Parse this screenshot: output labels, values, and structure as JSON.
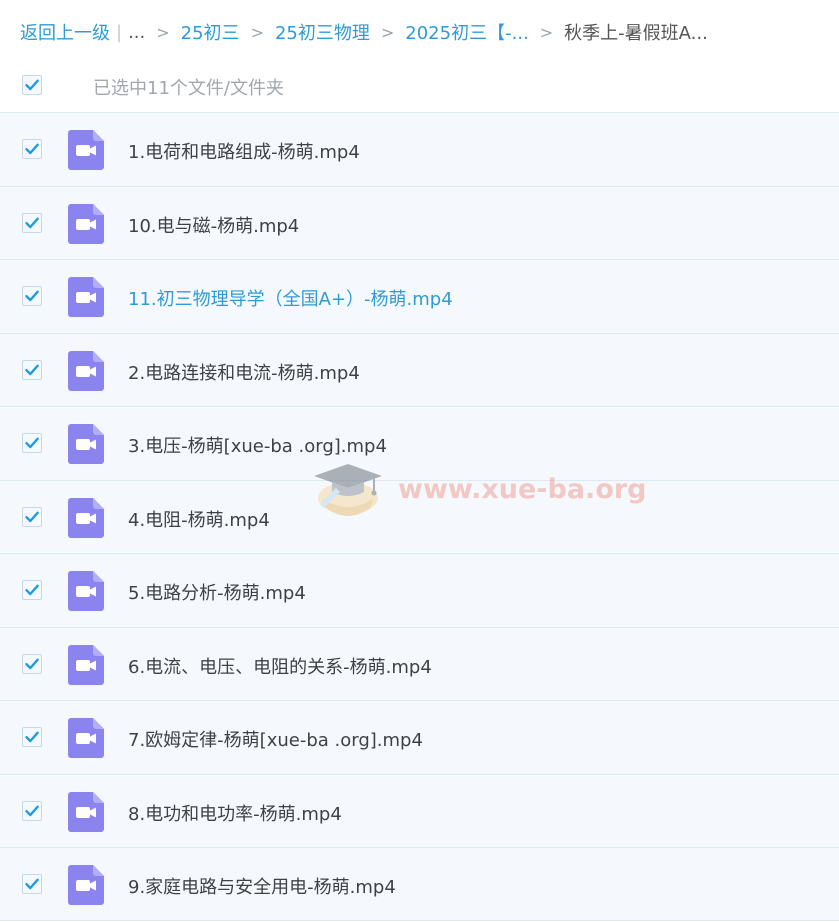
{
  "breadcrumb": {
    "back": "返回上一级",
    "ellipsis": "...",
    "items": [
      "25初三",
      "25初三物理",
      "2025初三【-..."
    ],
    "current": "秋季上-暑假班A..."
  },
  "selection": {
    "label": "已选中11个文件/文件夹"
  },
  "files": [
    {
      "name": "1.电荷和电路组成-杨萌.mp4"
    },
    {
      "name": "10.电与磁-杨萌.mp4"
    },
    {
      "name": "11.初三物理导学（全国A+）-杨萌.mp4"
    },
    {
      "name": "2.电路连接和电流-杨萌.mp4"
    },
    {
      "name": "3.电压-杨萌[xue-ba .org].mp4"
    },
    {
      "name": "4.电阻-杨萌.mp4"
    },
    {
      "name": "5.电路分析-杨萌.mp4"
    },
    {
      "name": "6.电流、电压、电阻的关系-杨萌.mp4"
    },
    {
      "name": "7.欧姆定律-杨萌[xue-ba .org].mp4"
    },
    {
      "name": "8.电功和电功率-杨萌.mp4"
    },
    {
      "name": "9.家庭电路与安全用电-杨萌.mp4"
    }
  ],
  "watermark": {
    "text": "www.xue-ba.org"
  },
  "colors": {
    "accent": "#2f9bd6",
    "checkmark": "#1e9be0",
    "video_icon": "#8b83ee",
    "row_bg": "#f5f9fd"
  }
}
